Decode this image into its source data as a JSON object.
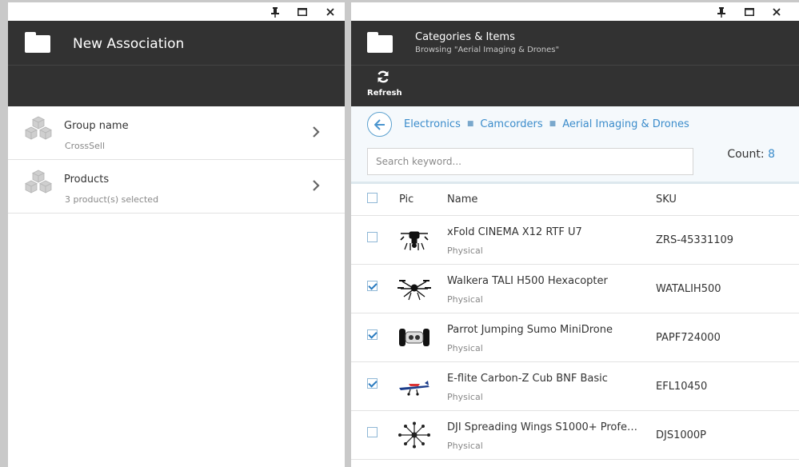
{
  "left_blade": {
    "title": "New Association",
    "window_controls": {
      "pin": "pin-icon",
      "maximize": "maximize-icon",
      "close": "close-icon"
    },
    "items": [
      {
        "title": "Group name",
        "subtitle": "CrossSell"
      },
      {
        "title": "Products",
        "subtitle": "3 product(s) selected"
      }
    ]
  },
  "right_blade": {
    "title": "Categories & Items",
    "subtitle": "Browsing \"Aerial Imaging & Drones\"",
    "toolbar": {
      "refresh_label": "Refresh"
    },
    "breadcrumbs": [
      "Electronics",
      "Camcorders",
      "Aerial Imaging & Drones"
    ],
    "search": {
      "placeholder": "Search keyword..."
    },
    "count_label": "Count:",
    "count_value": "8",
    "columns": {
      "pic": "Pic",
      "name": "Name",
      "sku": "SKU"
    },
    "rows": [
      {
        "name": "xFold CINEMA X12 RTF U7",
        "type": "Physical",
        "sku": "ZRS-45331109",
        "checked": false
      },
      {
        "name": "Walkera TALI H500 Hexacopter",
        "type": "Physical",
        "sku": "WATALIH500",
        "checked": true
      },
      {
        "name": "Parrot Jumping Sumo MiniDrone",
        "type": "Physical",
        "sku": "PAPF724000",
        "checked": true
      },
      {
        "name": "E-flite Carbon-Z Cub BNF Basic",
        "type": "Physical",
        "sku": "EFL10450",
        "checked": true
      },
      {
        "name": "DJI Spreading Wings S1000+ Profes…",
        "type": "Physical",
        "sku": "DJS1000P",
        "checked": false
      }
    ]
  },
  "colors": {
    "header_bg": "#323232",
    "accent": "#3b8ccb",
    "backdrop": "#c9c9c9"
  }
}
